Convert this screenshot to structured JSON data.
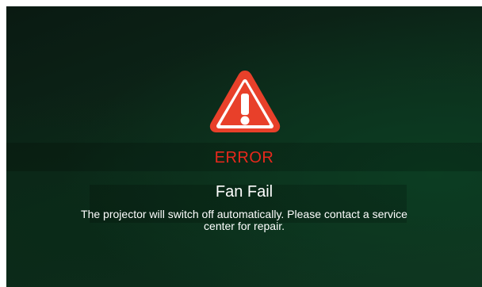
{
  "dialog": {
    "icon": "warning-triangle-icon",
    "title": "ERROR",
    "heading": "Fan Fail",
    "message": "The projector will switch off automatically. Please contact a service center for repair."
  },
  "colors": {
    "background": "#0d2a1a",
    "error_text": "#e8281c",
    "warning_fill": "#e8402a",
    "text": "#ffffff"
  }
}
